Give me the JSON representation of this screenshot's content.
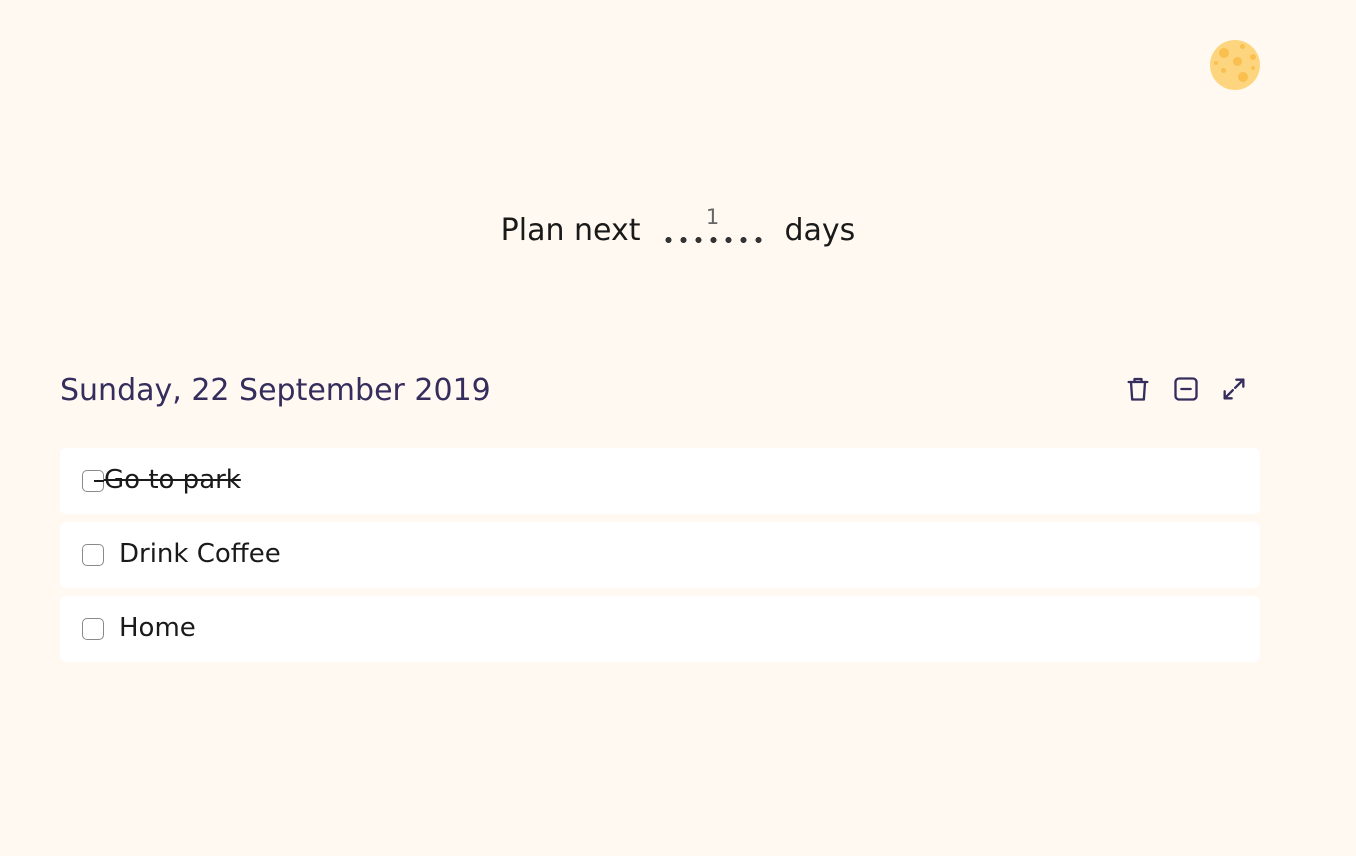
{
  "header": {
    "theme_toggle_icon": "moon-icon"
  },
  "plan": {
    "prefix": "Plan next",
    "days_value": "1",
    "suffix": "days"
  },
  "day": {
    "title": "Sunday, 22 September 2019",
    "actions": [
      {
        "name": "delete",
        "icon": "trash-icon"
      },
      {
        "name": "collapse",
        "icon": "minus-square-icon"
      },
      {
        "name": "expand",
        "icon": "maximize-icon"
      }
    ],
    "tasks": [
      {
        "label": "Go to park",
        "done": true
      },
      {
        "label": "Drink Coffee",
        "done": false
      },
      {
        "label": "Home",
        "done": false
      }
    ]
  },
  "colors": {
    "background": "#fff9f2",
    "accent": "#352d5c",
    "moon": "#fdd57e",
    "moon_crater": "#f9c04f"
  }
}
